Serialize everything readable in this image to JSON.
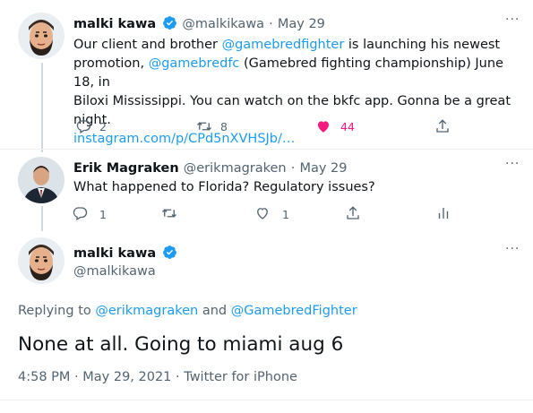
{
  "tweet1": {
    "name": "malki kawa",
    "handle": "@malkikawa",
    "dot": "·",
    "date": "May 29",
    "line1_pre": "Our client and brother ",
    "line1_mention": "@gamebredfighter",
    "line1_post": " is launching his newest",
    "line2_pre": "promotion, ",
    "line2_mention": "@gamebredfc",
    "line2_post": "  (Gamebred fighting championship) June 18, in",
    "line3": "Biloxi Mississippi. You can watch on the bkfc app. Gonna be a great night.",
    "line4_link": "instagram.com/p/CPd5nXVHSJb/…",
    "reply_count": "2",
    "retweet_count": "8",
    "like_count": "44",
    "more": "···"
  },
  "tweet2": {
    "name": "Erik Magraken",
    "handle": "@erikmagraken",
    "dot": "·",
    "date": "May 29",
    "text": "What happened to Florida?  Regulatory issues?",
    "reply_count": "1",
    "like_count": "1",
    "more": "···"
  },
  "main": {
    "name": "malki kawa",
    "handle": "@malkikawa",
    "replying_prefix": "Replying to ",
    "replying_mention1": "@erikmagraken",
    "replying_and": " and ",
    "replying_mention2": "@GamebredFighter",
    "text": "None at all. Going to miami aug 6",
    "timestamp": "4:58 PM · May 29, 2021 · Twitter for iPhone",
    "more": "···"
  },
  "colors": {
    "accent": "#1d9bf0",
    "like": "#f91880",
    "muted": "#536471"
  },
  "icons": [
    "verified-badge-icon",
    "reply-icon",
    "retweet-icon",
    "like-icon",
    "share-icon",
    "analytics-icon",
    "more-icon"
  ]
}
